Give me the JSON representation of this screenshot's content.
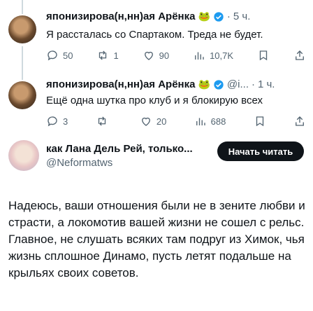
{
  "tweets": [
    {
      "author": "японизирова(н,нн)ая Арёнка",
      "emoji": "🐸",
      "handle": "",
      "time": "5 ч.",
      "text": "Я рассталась со Спартаком. Треда не будет.",
      "replies": "50",
      "retweets": "1",
      "likes": "90",
      "views": "10,7K"
    },
    {
      "author": "японизирова(н,нн)ая Арёнка",
      "emoji": "🐸",
      "handle": "@i...",
      "time": "1 ч.",
      "text": "Ещё одна шутка про клуб и я блокирую всех",
      "replies": "3",
      "retweets": "",
      "likes": "20",
      "views": "688"
    }
  ],
  "card": {
    "name": "как Лана Дель Рей, только...",
    "handle": "@Neformatws",
    "subscribe_label": "Начать читать",
    "text": "Надеюсь, ваши отношения были не в зените любви и страсти, а локомотив вашей жизни не сошел с рельс. Главное, не слушать всяких там подруг из Химок, чья жизнь сплошное Динамо, пусть летят подальше на крыльях своих советов."
  },
  "colors": {
    "verified": "#1d9bf0",
    "muted": "#536471",
    "text": "#0f1419",
    "thread_line": "#cfd9de"
  },
  "icons": [
    "reply-icon",
    "retweet-icon",
    "like-icon",
    "views-icon",
    "bookmark-icon",
    "share-icon",
    "verified-icon"
  ]
}
